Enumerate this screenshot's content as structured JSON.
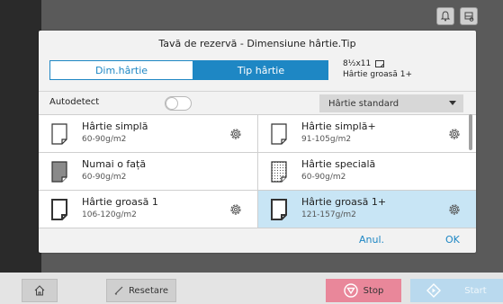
{
  "dialog": {
    "title": "Tavă de rezervă - Dimensiune hârtie.Tip"
  },
  "tabs": {
    "size_label": "Dim.hârtie",
    "type_label": "Tip hârtie",
    "info_size": "8½x11",
    "info_type": "Hârtie groasă 1+"
  },
  "autodetect": {
    "label": "Autodetect",
    "enabled": false
  },
  "filter": {
    "selected": "Hârtie standard"
  },
  "paper_types": [
    {
      "name": "Hârtie simplă",
      "weight": "60-90g/m2"
    },
    {
      "name": "Hârtie simplă+",
      "weight": "91-105g/m2"
    },
    {
      "name": "Numai o față",
      "weight": "60-90g/m2"
    },
    {
      "name": "Hârtie specială",
      "weight": "60-90g/m2"
    },
    {
      "name": "Hârtie groasă 1",
      "weight": "106-120g/m2"
    },
    {
      "name": "Hârtie groasă 1+",
      "weight": "121-157g/m2"
    }
  ],
  "footer": {
    "cancel_label": "Anul.",
    "ok_label": "OK"
  },
  "bottom": {
    "reset_label": "Resetare",
    "stop_label": "Stop",
    "start_label": "Start"
  },
  "colors": {
    "accent": "#1e87c4",
    "selected_row": "#c8e5f5",
    "stop": "#e9879a",
    "start": "#b9d9ee"
  },
  "icons": {
    "top_1": "bell-icon",
    "top_2": "tray-icon",
    "home": "home-icon",
    "reset": "eraser-icon",
    "stop": "stop-icon",
    "start": "start-diamond-icon"
  }
}
